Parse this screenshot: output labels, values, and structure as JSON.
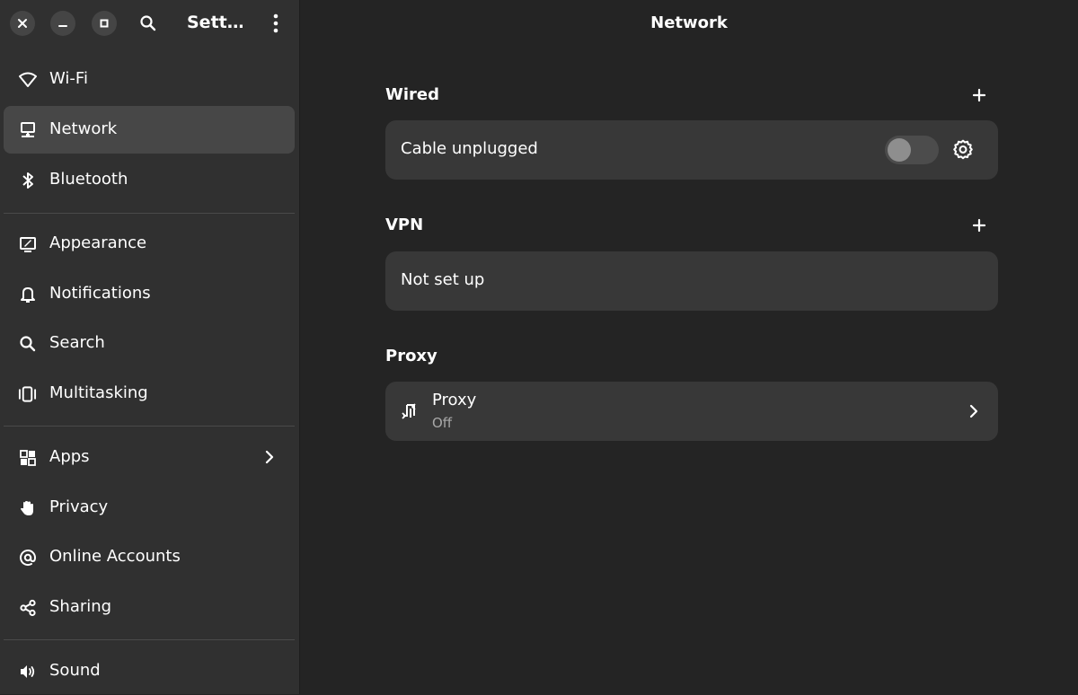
{
  "window": {
    "sidebar_title": "Sett…",
    "main_title": "Network"
  },
  "sidebar": {
    "items": [
      {
        "label": "Wi-Fi",
        "icon": "wifi-icon"
      },
      {
        "label": "Network",
        "icon": "network-icon",
        "selected": true
      },
      {
        "label": "Bluetooth",
        "icon": "bluetooth-icon"
      },
      {
        "label": "Appearance",
        "icon": "appearance-icon"
      },
      {
        "label": "Notifications",
        "icon": "bell-icon"
      },
      {
        "label": "Search",
        "icon": "search-icon"
      },
      {
        "label": "Multitasking",
        "icon": "multitasking-icon"
      },
      {
        "label": "Apps",
        "icon": "apps-grid-icon",
        "has_submenu": true
      },
      {
        "label": "Privacy",
        "icon": "hand-icon"
      },
      {
        "label": "Online Accounts",
        "icon": "at-sign-icon"
      },
      {
        "label": "Sharing",
        "icon": "share-icon"
      },
      {
        "label": "Sound",
        "icon": "speaker-icon"
      }
    ]
  },
  "main": {
    "wired": {
      "title": "Wired",
      "status": "Cable unplugged",
      "toggle_on": false
    },
    "vpn": {
      "title": "VPN",
      "status": "Not set up"
    },
    "proxy": {
      "title": "Proxy",
      "row_title": "Proxy",
      "row_subtitle": "Off"
    }
  },
  "colors": {
    "sidebar_bg": "#303030",
    "main_bg": "#242424",
    "card_bg": "#383838",
    "selected_bg": "#474747"
  }
}
